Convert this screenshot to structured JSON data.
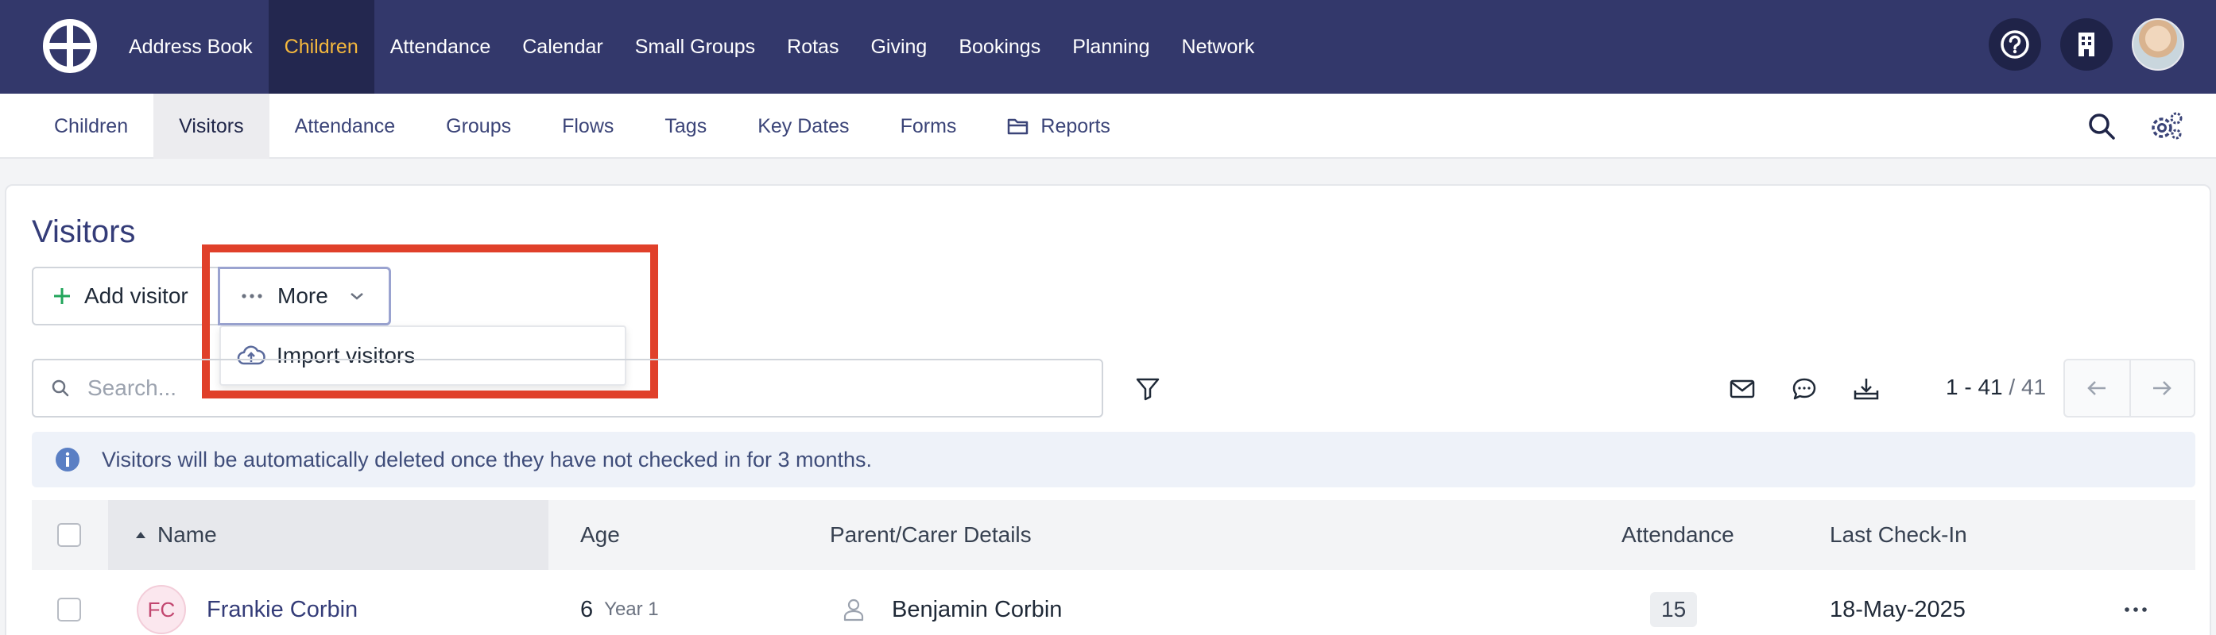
{
  "top_nav": {
    "items": [
      {
        "label": "Address Book"
      },
      {
        "label": "Children",
        "active": true
      },
      {
        "label": "Attendance"
      },
      {
        "label": "Calendar"
      },
      {
        "label": "Small Groups"
      },
      {
        "label": "Rotas"
      },
      {
        "label": "Giving"
      },
      {
        "label": "Bookings"
      },
      {
        "label": "Planning"
      },
      {
        "label": "Network"
      }
    ],
    "active_color": "#f5b83d",
    "bar_color": "#33386b"
  },
  "sub_nav": {
    "items": [
      {
        "label": "Children"
      },
      {
        "label": "Visitors",
        "active": true
      },
      {
        "label": "Attendance"
      },
      {
        "label": "Groups"
      },
      {
        "label": "Flows"
      },
      {
        "label": "Tags"
      },
      {
        "label": "Key Dates"
      },
      {
        "label": "Forms"
      },
      {
        "label": "Reports",
        "icon": "folder-icon"
      }
    ]
  },
  "page": {
    "title": "Visitors",
    "add_button": "Add visitor",
    "more_button": "More",
    "dropdown": {
      "import_label": "Import visitors"
    },
    "highlight_color": "#e0402a"
  },
  "search": {
    "placeholder": "Search..."
  },
  "pagination": {
    "range": "1 - 41",
    "separator": " / ",
    "total": "41"
  },
  "info_banner": {
    "text": "Visitors will be automatically deleted once they have not checked in for 3 months."
  },
  "table": {
    "columns": {
      "name": "Name",
      "age": "Age",
      "parent": "Parent/Carer Details",
      "attendance": "Attendance",
      "last_checkin": "Last Check-In"
    },
    "rows": [
      {
        "initials": "FC",
        "name": "Frankie Corbin",
        "age": "6",
        "year": "Year 1",
        "parent": "Benjamin Corbin",
        "attendance": "15",
        "last_checkin": "18-May-2025"
      }
    ]
  }
}
